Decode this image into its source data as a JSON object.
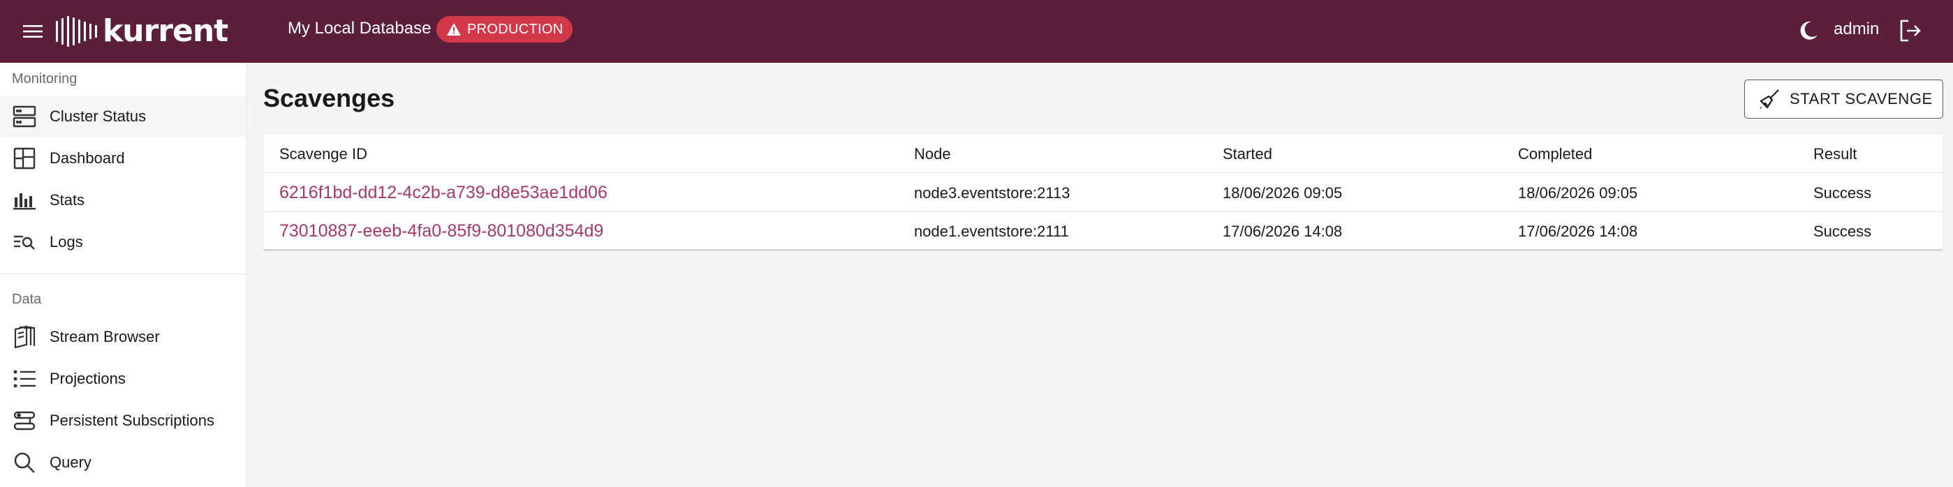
{
  "topbar": {
    "logo_text": "kurrent",
    "database_name": "My Local Database",
    "environment_badge": "PRODUCTION",
    "user": "admin",
    "icons": {
      "menu": "hamburger-icon",
      "theme": "moon-icon",
      "logout": "logout-icon",
      "warning": "warning-triangle-icon"
    }
  },
  "sidebar": {
    "sections": [
      {
        "label": "Monitoring",
        "items": [
          {
            "label": "Cluster Status",
            "icon": "server-icon",
            "active": true
          },
          {
            "label": "Dashboard",
            "icon": "dashboard-icon"
          },
          {
            "label": "Stats",
            "icon": "bar-chart-icon"
          },
          {
            "label": "Logs",
            "icon": "log-search-icon"
          }
        ]
      },
      {
        "label": "Data",
        "items": [
          {
            "label": "Stream Browser",
            "icon": "stream-icon"
          },
          {
            "label": "Projections",
            "icon": "list-icon"
          },
          {
            "label": "Persistent Subscriptions",
            "icon": "subscription-icon"
          },
          {
            "label": "Query",
            "icon": "search-icon"
          }
        ]
      }
    ]
  },
  "main": {
    "title": "Scavenges",
    "start_button_label": "START SCAVENGE",
    "table": {
      "columns": [
        "Scavenge ID",
        "Node",
        "Started",
        "Completed",
        "Result"
      ],
      "rows": [
        [
          "6216f1bd-dd12-4c2b-a739-d8e53ae1dd06",
          "node3.eventstore:2113",
          "18/06/2026 09:05",
          "18/06/2026 09:05",
          "Success"
        ],
        [
          "73010887-eeeb-4fa0-85f9-801080d354d9",
          "node1.eventstore:2111",
          "17/06/2026 14:08",
          "17/06/2026 14:08",
          "Success"
        ]
      ]
    }
  },
  "colors": {
    "topbar": "#5b1f3a",
    "badge": "#d1394a",
    "link": "#a33a67"
  }
}
